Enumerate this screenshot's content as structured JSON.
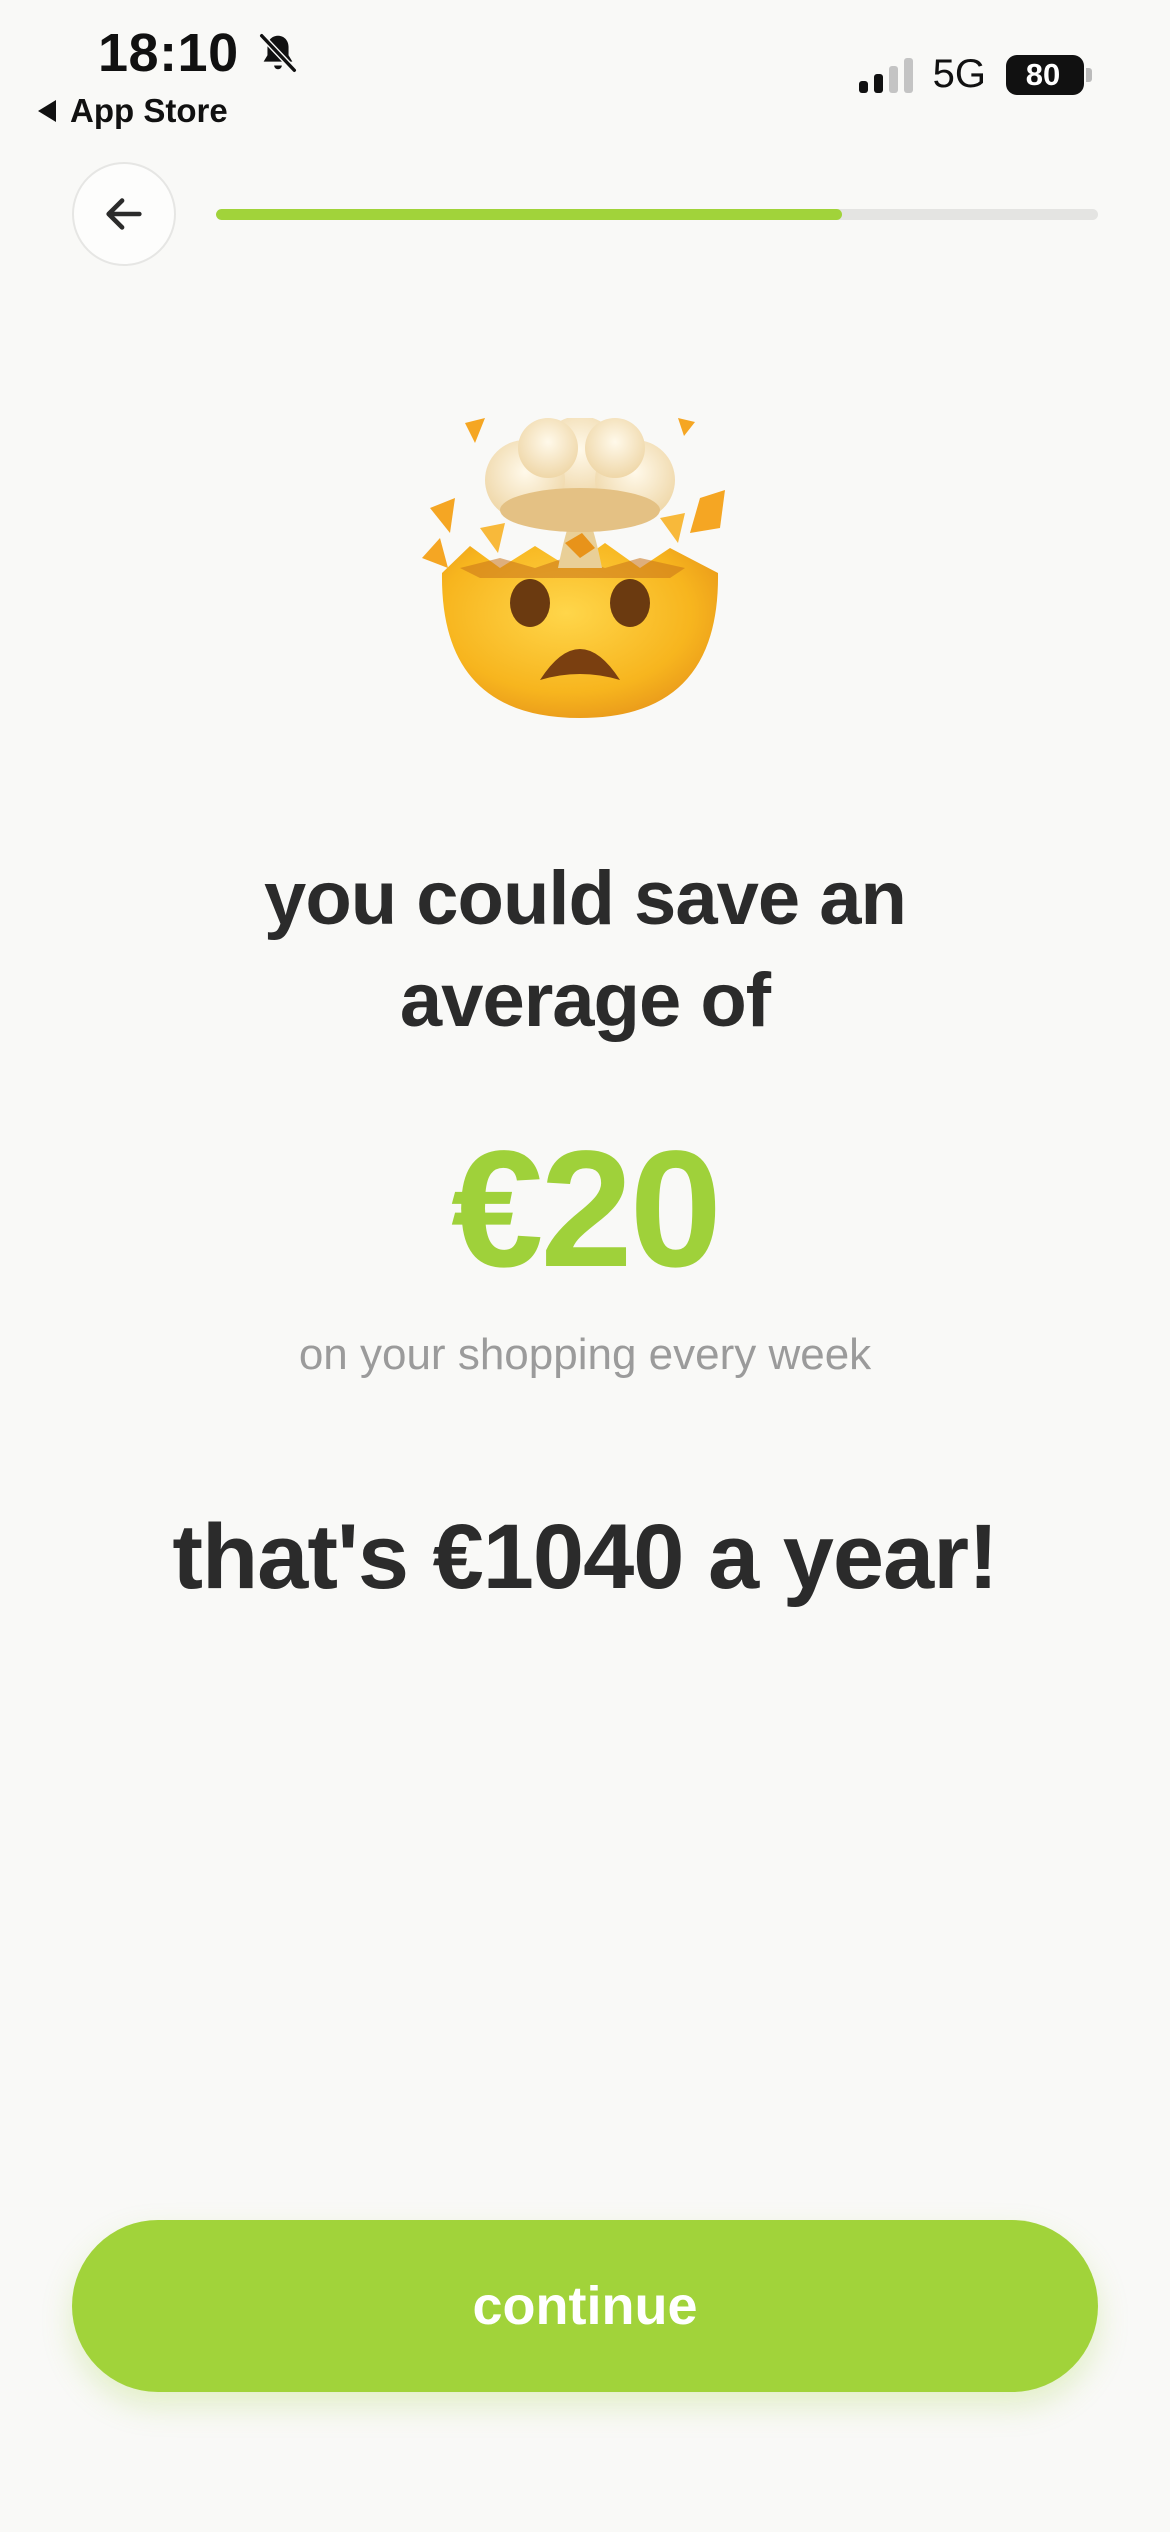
{
  "status_bar": {
    "time": "18:10",
    "back_app": "App Store",
    "network": "5G",
    "battery": "80",
    "icons": {
      "bell_off": "bell-off-icon",
      "signal": "signal-icon",
      "battery": "battery-icon"
    },
    "signal_bars_active": 2,
    "signal_bars_total": 4
  },
  "header": {
    "back_icon": "arrow-left-icon",
    "progress_fraction": 0.71
  },
  "main": {
    "emoji": "exploding-head-icon",
    "headline_line1": "you could save an",
    "headline_line2": "average of",
    "amount": "€20",
    "subtext": "on your shopping every week",
    "yearly": "that's €1040 a year!"
  },
  "footer": {
    "continue_label": "continue"
  },
  "colors": {
    "accent": "#a1d33a",
    "amount": "#9fd13a",
    "text": "#2b2b2b",
    "muted": "#9b9b9b",
    "background": "#f9f9f7"
  }
}
